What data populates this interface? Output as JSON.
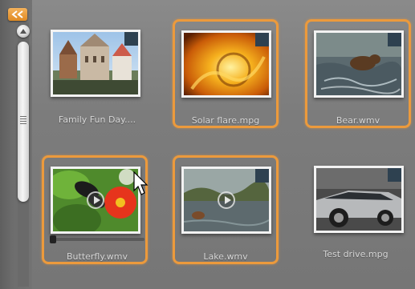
{
  "collapse_button": {
    "icon": "double-chevron-left-icon",
    "color": "#e08a22"
  },
  "scrollbar": {
    "up_icon": "scroll-up-triangle-icon"
  },
  "selection_color": "#ec9a3c",
  "items": [
    {
      "filename": "Family Fun Day....",
      "selected": false,
      "has_play_icon": false,
      "has_corner_badge": true
    },
    {
      "filename": "Solar flare.mpg",
      "selected": true,
      "has_play_icon": false,
      "has_corner_badge": true
    },
    {
      "filename": "Bear.wmv",
      "selected": true,
      "has_play_icon": false,
      "has_corner_badge": true
    },
    {
      "filename": "Butterfly.wmv",
      "selected": true,
      "has_play_icon": true,
      "has_corner_badge": false,
      "hovered": true
    },
    {
      "filename": "Lake.wmv",
      "selected": true,
      "has_play_icon": true,
      "has_corner_badge": true
    },
    {
      "filename": "Test drive.mpg",
      "selected": false,
      "has_play_icon": false,
      "has_corner_badge": true
    }
  ]
}
